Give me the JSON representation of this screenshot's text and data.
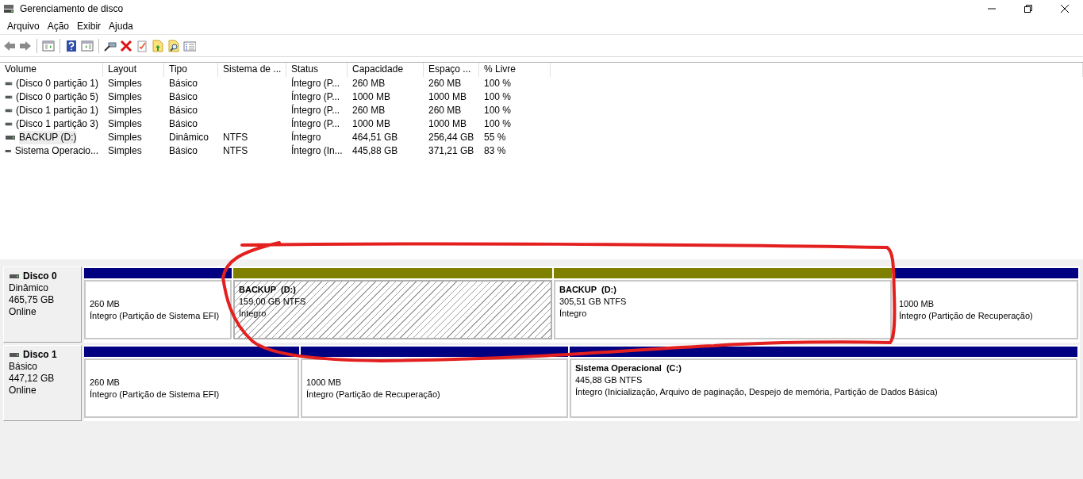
{
  "window": {
    "title": "Gerenciamento de disco"
  },
  "menu": [
    "Arquivo",
    "Ação",
    "Exibir",
    "Ajuda"
  ],
  "table": {
    "columns": [
      "Volume",
      "Layout",
      "Tipo",
      "Sistema de ...",
      "Status",
      "Capacidade",
      "Espaço ...",
      "% Livre"
    ],
    "rows": [
      {
        "cells": [
          "(Disco 0 partição 1)",
          "Simples",
          "Básico",
          "",
          "Íntegro (P...",
          "260 MB",
          "260 MB",
          "100 %"
        ],
        "selected": false
      },
      {
        "cells": [
          "(Disco 0 partição 5)",
          "Simples",
          "Básico",
          "",
          "Íntegro (P...",
          "1000 MB",
          "1000 MB",
          "100 %"
        ],
        "selected": false
      },
      {
        "cells": [
          "(Disco 1 partição 1)",
          "Simples",
          "Básico",
          "",
          "Íntegro (P...",
          "260 MB",
          "260 MB",
          "100 %"
        ],
        "selected": false
      },
      {
        "cells": [
          "(Disco 1 partição 3)",
          "Simples",
          "Básico",
          "",
          "Íntegro (P...",
          "1000 MB",
          "1000 MB",
          "100 %"
        ],
        "selected": false
      },
      {
        "cells": [
          "BACKUP (D:)",
          "Simples",
          "Dinâmico",
          "NTFS",
          "Íntegro",
          "464,51 GB",
          "256,44 GB",
          "55 %"
        ],
        "selected": true
      },
      {
        "cells": [
          "Sistema Operacio...",
          "Simples",
          "Básico",
          "NTFS",
          "Íntegro (In...",
          "445,88 GB",
          "371,21 GB",
          "83 %"
        ],
        "selected": false
      }
    ]
  },
  "disks": [
    {
      "name": "Disco 0",
      "type": "Dinâmico",
      "size": "465,75 GB",
      "status": "Online",
      "partitions": [
        {
          "size": "260 MB",
          "status": "Íntegro (Partição de Sistema EFI)",
          "color": "#000080",
          "selected": false
        },
        {
          "name": "BACKUP  (D:)",
          "size": "159,00 GB NTFS",
          "status": "Íntegro",
          "color": "#808000",
          "selected": true
        },
        {
          "name": "BACKUP  (D:)",
          "size": "305,51 GB NTFS",
          "status": "Íntegro",
          "color": "#808000",
          "selected": false
        },
        {
          "size": "1000 MB",
          "status": "Íntegro (Partição de Recuperação)",
          "color": "#000080",
          "selected": false
        }
      ]
    },
    {
      "name": "Disco 1",
      "type": "Básico",
      "size": "447,12 GB",
      "status": "Online",
      "partitions": [
        {
          "size": "260 MB",
          "status": "Íntegro (Partição de Sistema EFI)",
          "color": "#000080",
          "selected": false
        },
        {
          "size": "1000 MB",
          "status": "Íntegro (Partição de Recuperação)",
          "color": "#000080",
          "selected": false
        },
        {
          "name": "Sistema Operacional  (C:)",
          "size": "445,88 GB NTFS",
          "status": "Íntegro (Inicialização, Arquivo de paginação, Despejo de memória, Partição de Dados Básica)",
          "color": "#000080",
          "selected": false
        }
      ]
    }
  ]
}
